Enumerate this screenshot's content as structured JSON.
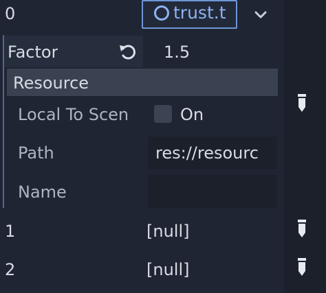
{
  "rows": [
    {
      "index": "0",
      "value": "trust.t"
    },
    {
      "index": "1",
      "value": "[null]"
    },
    {
      "index": "2",
      "value": "[null]"
    }
  ],
  "factor": {
    "label": "Factor",
    "value": "1.5"
  },
  "resource": {
    "header": "Resource",
    "local_to_scene": {
      "label": "Local To Scen",
      "checkbox_text": "On",
      "checked": false
    },
    "path": {
      "label": "Path",
      "value": "res://resourc"
    },
    "name": {
      "label": "Name",
      "value": ""
    }
  },
  "icons": {
    "resource": "circle-ring-icon",
    "dropdown": "chevron-down-icon",
    "revert": "revert-icon",
    "edit": "pencil-icon"
  },
  "colors": {
    "background": "#1f2533",
    "accent": "#6d97d8",
    "header": "#3a4150"
  }
}
